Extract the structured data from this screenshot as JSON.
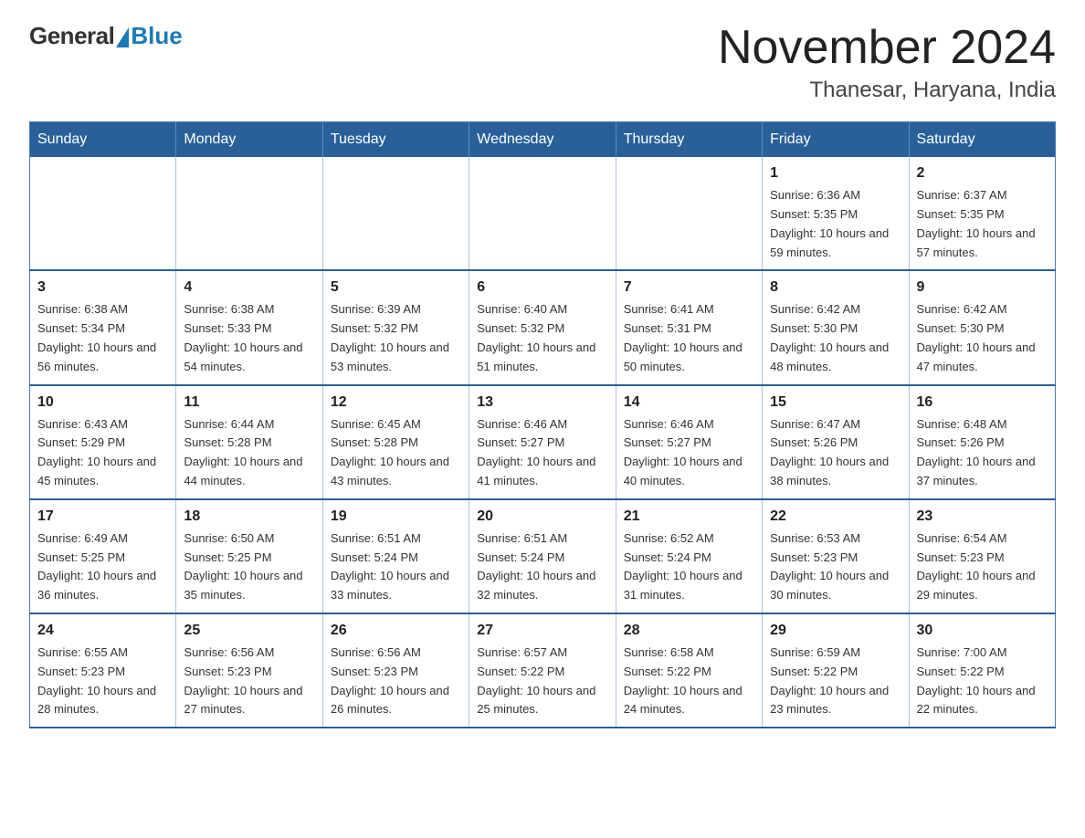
{
  "logo": {
    "general": "General",
    "blue": "Blue"
  },
  "header": {
    "title": "November 2024",
    "subtitle": "Thanesar, Haryana, India"
  },
  "weekdays": [
    "Sunday",
    "Monday",
    "Tuesday",
    "Wednesday",
    "Thursday",
    "Friday",
    "Saturday"
  ],
  "weeks": [
    [
      {
        "day": "",
        "info": ""
      },
      {
        "day": "",
        "info": ""
      },
      {
        "day": "",
        "info": ""
      },
      {
        "day": "",
        "info": ""
      },
      {
        "day": "",
        "info": ""
      },
      {
        "day": "1",
        "info": "Sunrise: 6:36 AM\nSunset: 5:35 PM\nDaylight: 10 hours and 59 minutes."
      },
      {
        "day": "2",
        "info": "Sunrise: 6:37 AM\nSunset: 5:35 PM\nDaylight: 10 hours and 57 minutes."
      }
    ],
    [
      {
        "day": "3",
        "info": "Sunrise: 6:38 AM\nSunset: 5:34 PM\nDaylight: 10 hours and 56 minutes."
      },
      {
        "day": "4",
        "info": "Sunrise: 6:38 AM\nSunset: 5:33 PM\nDaylight: 10 hours and 54 minutes."
      },
      {
        "day": "5",
        "info": "Sunrise: 6:39 AM\nSunset: 5:32 PM\nDaylight: 10 hours and 53 minutes."
      },
      {
        "day": "6",
        "info": "Sunrise: 6:40 AM\nSunset: 5:32 PM\nDaylight: 10 hours and 51 minutes."
      },
      {
        "day": "7",
        "info": "Sunrise: 6:41 AM\nSunset: 5:31 PM\nDaylight: 10 hours and 50 minutes."
      },
      {
        "day": "8",
        "info": "Sunrise: 6:42 AM\nSunset: 5:30 PM\nDaylight: 10 hours and 48 minutes."
      },
      {
        "day": "9",
        "info": "Sunrise: 6:42 AM\nSunset: 5:30 PM\nDaylight: 10 hours and 47 minutes."
      }
    ],
    [
      {
        "day": "10",
        "info": "Sunrise: 6:43 AM\nSunset: 5:29 PM\nDaylight: 10 hours and 45 minutes."
      },
      {
        "day": "11",
        "info": "Sunrise: 6:44 AM\nSunset: 5:28 PM\nDaylight: 10 hours and 44 minutes."
      },
      {
        "day": "12",
        "info": "Sunrise: 6:45 AM\nSunset: 5:28 PM\nDaylight: 10 hours and 43 minutes."
      },
      {
        "day": "13",
        "info": "Sunrise: 6:46 AM\nSunset: 5:27 PM\nDaylight: 10 hours and 41 minutes."
      },
      {
        "day": "14",
        "info": "Sunrise: 6:46 AM\nSunset: 5:27 PM\nDaylight: 10 hours and 40 minutes."
      },
      {
        "day": "15",
        "info": "Sunrise: 6:47 AM\nSunset: 5:26 PM\nDaylight: 10 hours and 38 minutes."
      },
      {
        "day": "16",
        "info": "Sunrise: 6:48 AM\nSunset: 5:26 PM\nDaylight: 10 hours and 37 minutes."
      }
    ],
    [
      {
        "day": "17",
        "info": "Sunrise: 6:49 AM\nSunset: 5:25 PM\nDaylight: 10 hours and 36 minutes."
      },
      {
        "day": "18",
        "info": "Sunrise: 6:50 AM\nSunset: 5:25 PM\nDaylight: 10 hours and 35 minutes."
      },
      {
        "day": "19",
        "info": "Sunrise: 6:51 AM\nSunset: 5:24 PM\nDaylight: 10 hours and 33 minutes."
      },
      {
        "day": "20",
        "info": "Sunrise: 6:51 AM\nSunset: 5:24 PM\nDaylight: 10 hours and 32 minutes."
      },
      {
        "day": "21",
        "info": "Sunrise: 6:52 AM\nSunset: 5:24 PM\nDaylight: 10 hours and 31 minutes."
      },
      {
        "day": "22",
        "info": "Sunrise: 6:53 AM\nSunset: 5:23 PM\nDaylight: 10 hours and 30 minutes."
      },
      {
        "day": "23",
        "info": "Sunrise: 6:54 AM\nSunset: 5:23 PM\nDaylight: 10 hours and 29 minutes."
      }
    ],
    [
      {
        "day": "24",
        "info": "Sunrise: 6:55 AM\nSunset: 5:23 PM\nDaylight: 10 hours and 28 minutes."
      },
      {
        "day": "25",
        "info": "Sunrise: 6:56 AM\nSunset: 5:23 PM\nDaylight: 10 hours and 27 minutes."
      },
      {
        "day": "26",
        "info": "Sunrise: 6:56 AM\nSunset: 5:23 PM\nDaylight: 10 hours and 26 minutes."
      },
      {
        "day": "27",
        "info": "Sunrise: 6:57 AM\nSunset: 5:22 PM\nDaylight: 10 hours and 25 minutes."
      },
      {
        "day": "28",
        "info": "Sunrise: 6:58 AM\nSunset: 5:22 PM\nDaylight: 10 hours and 24 minutes."
      },
      {
        "day": "29",
        "info": "Sunrise: 6:59 AM\nSunset: 5:22 PM\nDaylight: 10 hours and 23 minutes."
      },
      {
        "day": "30",
        "info": "Sunrise: 7:00 AM\nSunset: 5:22 PM\nDaylight: 10 hours and 22 minutes."
      }
    ]
  ]
}
